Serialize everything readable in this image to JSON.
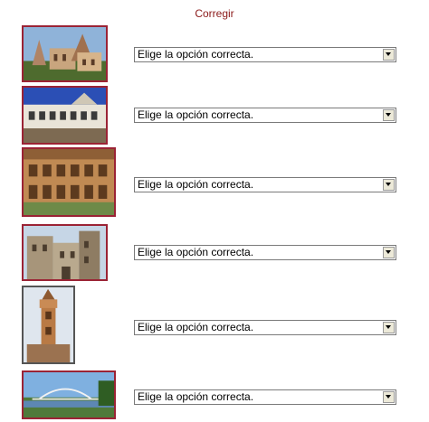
{
  "header": {
    "correct_label": "Corregir"
  },
  "questions": [
    {
      "select_value": "Elige la opción correcta."
    },
    {
      "select_value": "Elige la opción correcta."
    },
    {
      "select_value": "Elige la opción correcta."
    },
    {
      "select_value": "Elige la opción correcta."
    },
    {
      "select_value": "Elige la opción correcta."
    },
    {
      "select_value": "Elige la opción correcta."
    }
  ]
}
